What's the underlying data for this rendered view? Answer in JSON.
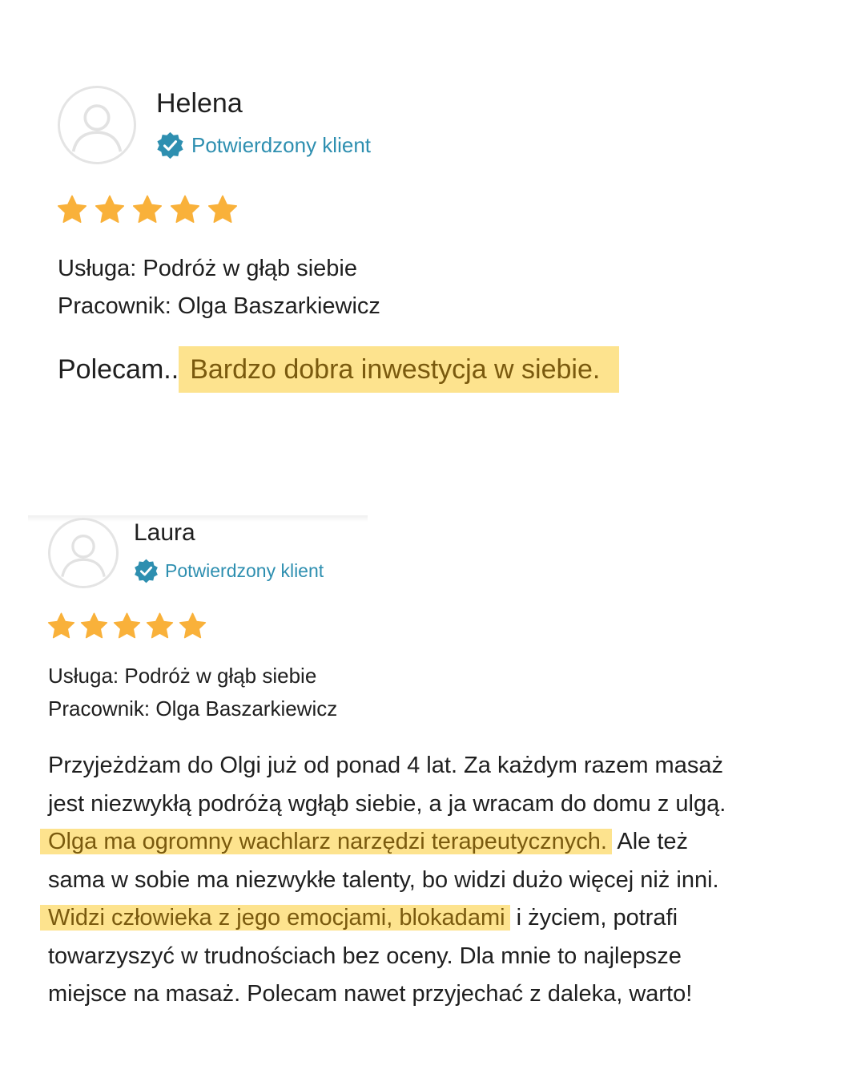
{
  "reviews": [
    {
      "name": "Helena",
      "verified_label": "Potwierdzony klient",
      "rating": 5,
      "service": "Usługa: Podróż w głąb siebie",
      "employee": "Pracownik: Olga Baszarkiewicz",
      "text_plain": "Polecam..",
      "text_highlight": "Bardzo dobra inwestycja w siebie."
    },
    {
      "name": "Laura",
      "verified_label": "Potwierdzony klient",
      "rating": 5,
      "service": "Usługa: Podróż w głąb siebie",
      "employee": "Pracownik: Olga Baszarkiewicz",
      "text": {
        "line1": "Przyjeżdżam do Olgi już od ponad 4 lat. Za każdym razem masaż",
        "line2": "jest niezwykłą podróżą wgłąb siebie, a ja wracam do domu z ulgą.",
        "line3_highlight": "Olga ma ogromny wachlarz narzędzi terapeutycznych.",
        "line3_plain": " Ale też",
        "line4": "sama w sobie ma niezwykłe talenty, bo widzi dużo więcej niż inni.",
        "line5_highlight": "Widzi człowieka z jego emocjami, blokadami",
        "line5_plain": " i życiem, potrafi",
        "line6": "towarzyszyć w trudnościach bez oceny. Dla mnie to najlepsze",
        "line7": "miejsce na masaż. Polecam nawet przyjechać z daleka, warto!"
      }
    }
  ],
  "colors": {
    "verified": "#2e8fb0",
    "star": "#f9b13a",
    "highlight_bg": "#fde38e",
    "highlight_text": "#7a5a0e"
  },
  "icons": {
    "avatar": "user-placeholder-icon",
    "verified": "verified-check-badge-icon",
    "star": "star-icon"
  }
}
